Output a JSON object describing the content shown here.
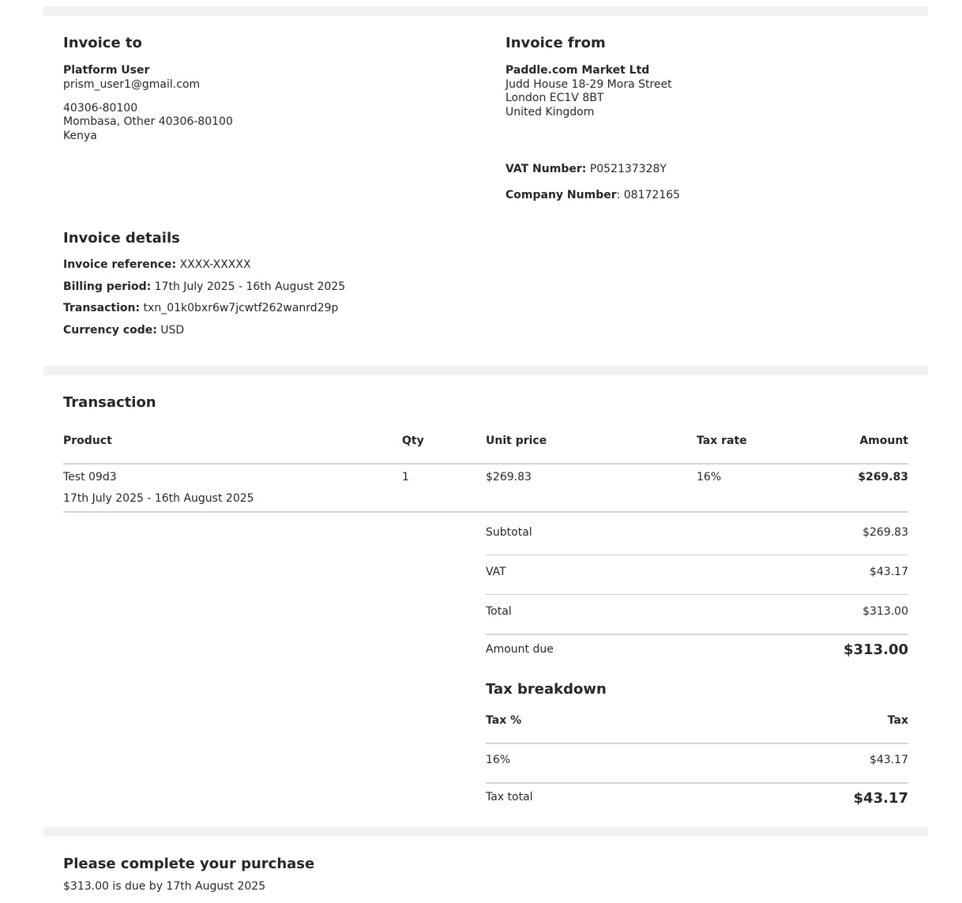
{
  "invoice_to": {
    "heading": "Invoice to",
    "name": "Platform User",
    "email": "prism_user1@gmail.com",
    "address_line1": "40306-80100",
    "address_line2": "Mombasa, Other 40306-80100",
    "address_line3": "Kenya"
  },
  "invoice_from": {
    "heading": "Invoice from",
    "name": "Paddle.com Market Ltd",
    "address_line1": "Judd House 18-29 Mora Street",
    "address_line2": "London EC1V 8BT",
    "address_line3": "United Kingdom",
    "vat_label": "VAT Number:",
    "vat_value": "P052137328Y",
    "company_label": "Company Number",
    "company_value": ": 08172165"
  },
  "invoice_details": {
    "heading": "Invoice details",
    "reference_label": "Invoice reference:",
    "reference_value": "XXXX-XXXXX",
    "billing_label": "Billing period:",
    "billing_value": "17th July 2025 - 16th August 2025",
    "transaction_label": "Transaction:",
    "transaction_value": "txn_01k0bxr6w7jcwtf262wanrd29p",
    "currency_label": "Currency code:",
    "currency_value": "USD"
  },
  "transaction": {
    "heading": "Transaction",
    "columns": [
      "Product",
      "Qty",
      "Unit price",
      "Tax rate",
      "Amount"
    ],
    "items": [
      {
        "product": "Test 09d3",
        "period": "17th July 2025 - 16th August 2025",
        "qty": "1",
        "unit_price": "$269.83",
        "tax_rate": "16%",
        "amount": "$269.83"
      }
    ],
    "subtotal_label": "Subtotal",
    "subtotal_value": "$269.83",
    "vat_label": "VAT",
    "vat_value": "$43.17",
    "total_label": "Total",
    "total_value": "$313.00",
    "amount_due_label": "Amount due",
    "amount_due_value": "$313.00"
  },
  "tax_breakdown": {
    "heading": "Tax breakdown",
    "col_percent": "Tax %",
    "col_tax": "Tax",
    "rows": [
      {
        "percent": "16%",
        "tax": "$43.17"
      }
    ],
    "total_label": "Tax total",
    "total_value": "$43.17"
  },
  "footer": {
    "heading": "Please complete your purchase",
    "due_text": "$313.00 is due by 17th August 2025"
  }
}
